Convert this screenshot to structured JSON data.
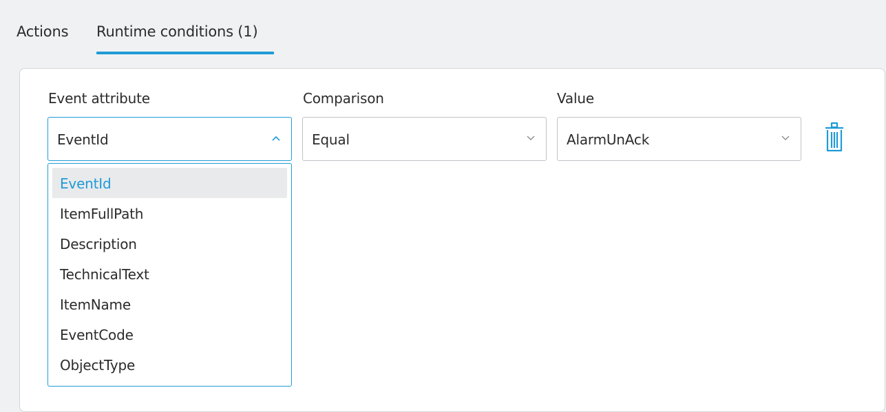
{
  "tabs": [
    {
      "label": "Actions",
      "active": false
    },
    {
      "label": "Runtime conditions (1)",
      "active": true
    }
  ],
  "condition": {
    "event_attribute": {
      "label": "Event attribute",
      "value": "EventId",
      "open": true
    },
    "comparison": {
      "label": "Comparison",
      "value": "Equal"
    },
    "value": {
      "label": "Value",
      "value": "AlarmUnAck"
    },
    "delete_icon": "trash-icon"
  },
  "dropdown": {
    "options": [
      "EventId",
      "ItemFullPath",
      "Description",
      "TechnicalText",
      "ItemName",
      "EventCode",
      "ObjectType"
    ],
    "selected": "EventId"
  },
  "colors": {
    "accent": "#1f9bd7",
    "background": "#f0f1f3",
    "panel": "#ffffff",
    "selected_option_bg": "#e9eaec"
  }
}
